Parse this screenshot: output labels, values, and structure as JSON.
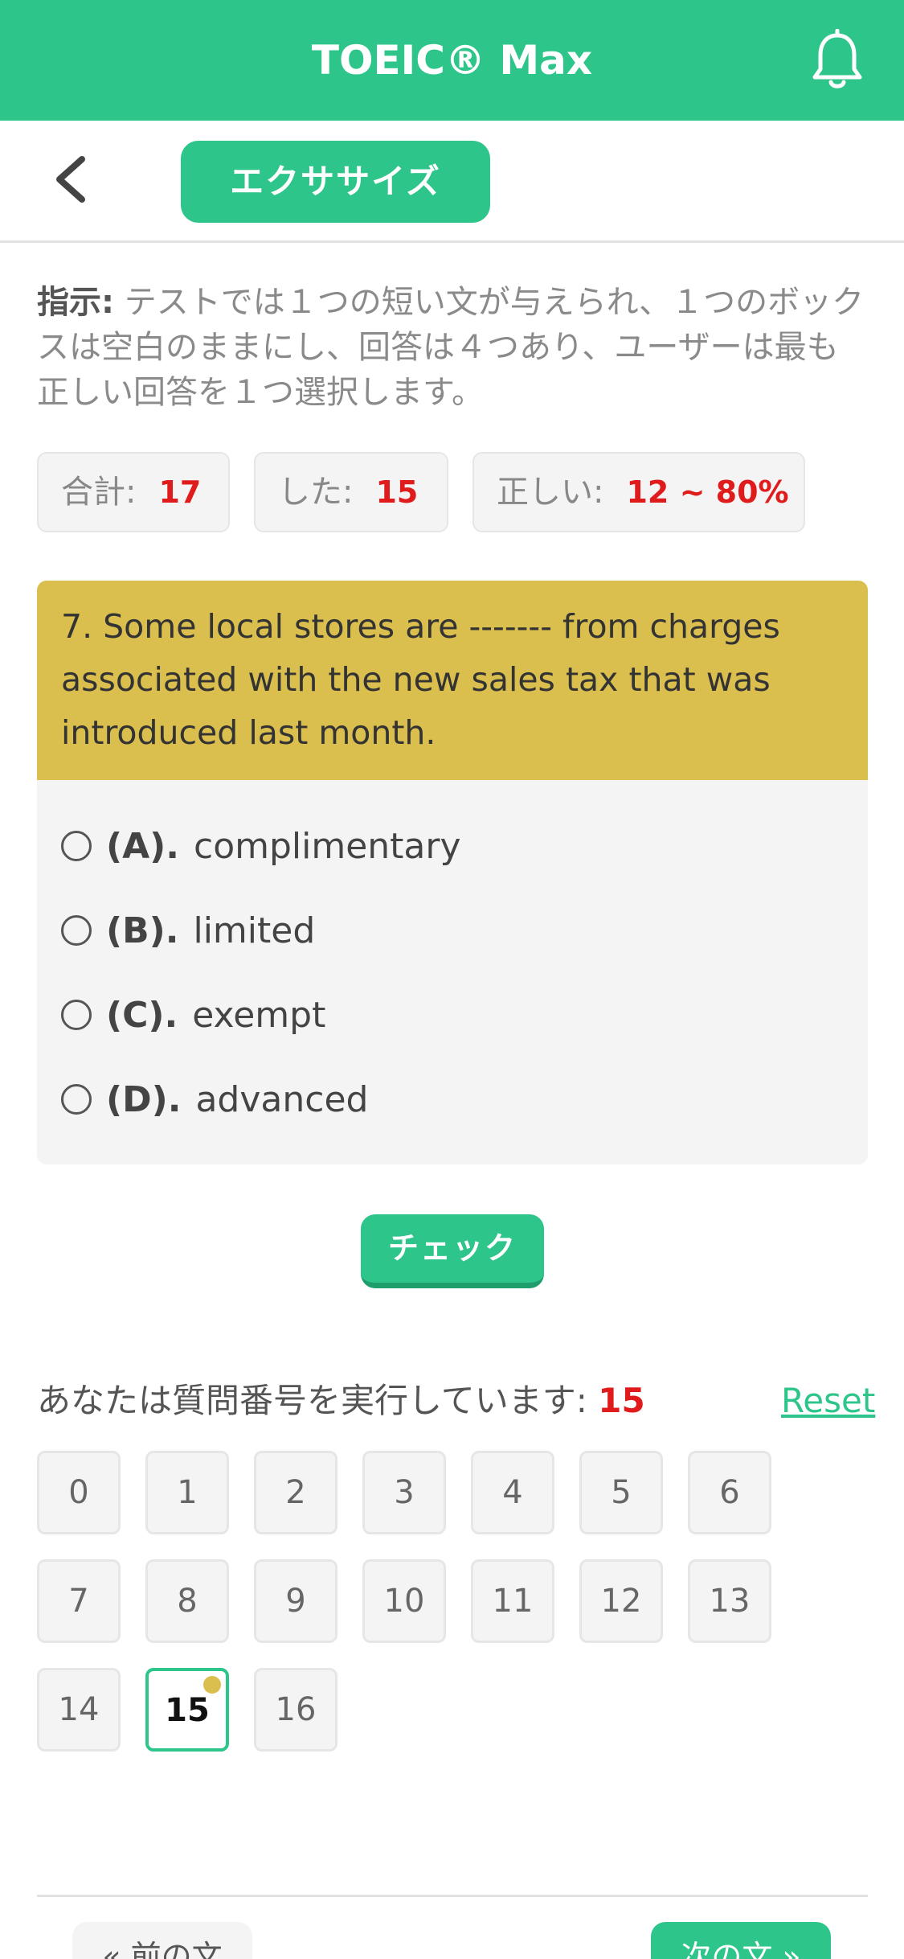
{
  "app": {
    "title": "TOEIC® Max"
  },
  "subbar": {
    "exercise_label": "エクササイズ"
  },
  "instruction": {
    "label": "指示:",
    "text": " テストでは１つの短い文が与えられ、１つのボックスは空白のままにし、回答は４つあり、ユーザーは最も正しい回答を１つ選択します。"
  },
  "stats": {
    "total_label": "合計:",
    "total_value": "17",
    "done_label": "した:",
    "done_value": "15",
    "correct_label": "正しい:",
    "correct_value": "12 ~ 80%"
  },
  "question": {
    "text": "7. Some local stores are ------- from charges associated with the new sales tax that was introduced last month.",
    "options": [
      {
        "letter": "(A).",
        "text": "complimentary"
      },
      {
        "letter": "(B).",
        "text": "limited"
      },
      {
        "letter": "(C).",
        "text": "exempt"
      },
      {
        "letter": "(D).",
        "text": "advanced"
      }
    ]
  },
  "check_label": "チェック",
  "progress": {
    "label": "あなたは質問番号を実行しています:",
    "current": "15",
    "reset_label": "Reset",
    "numbers": [
      "0",
      "1",
      "2",
      "3",
      "4",
      "5",
      "6",
      "7",
      "8",
      "9",
      "10",
      "11",
      "12",
      "13",
      "14",
      "15",
      "16"
    ]
  },
  "nav": {
    "prev_label": "« 前の文",
    "next_label": "次の文 »"
  },
  "colors": {
    "accent": "#2dc58a",
    "question_header": "#dbbf4e",
    "highlight": "#e01b1b"
  }
}
